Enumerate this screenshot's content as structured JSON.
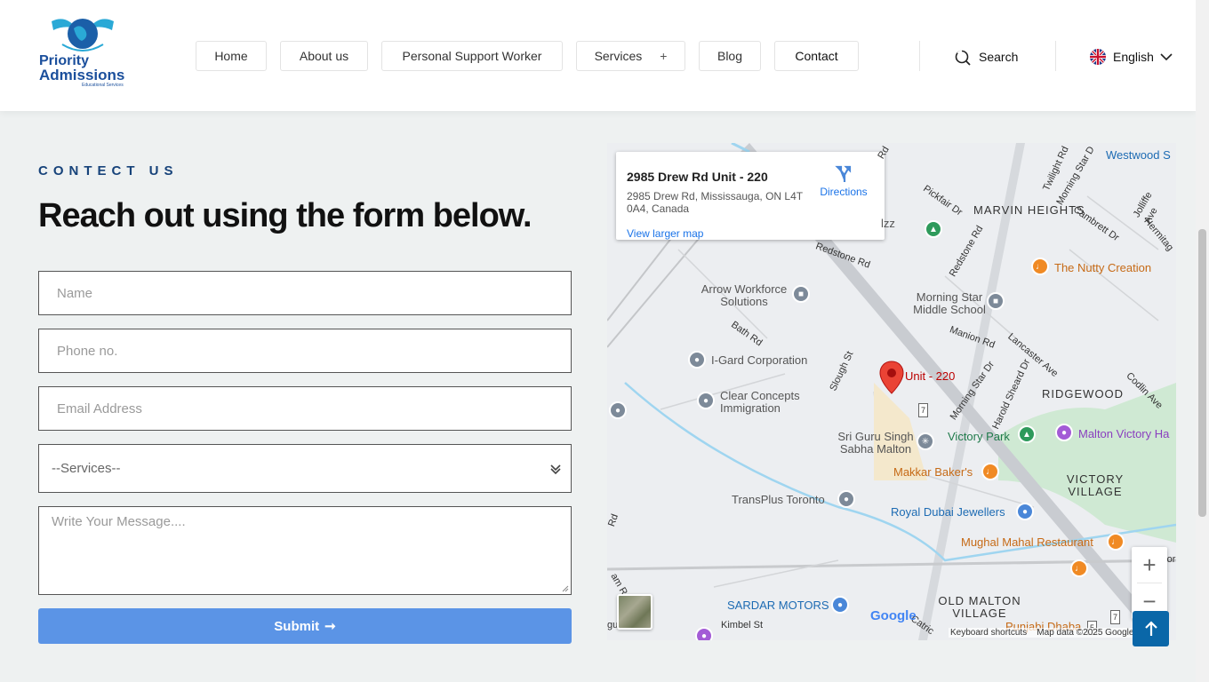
{
  "header": {
    "logo": {
      "line1": "Priority",
      "line2": "Admissions",
      "tagline": "Educational Services"
    },
    "nav": [
      {
        "label": "Home"
      },
      {
        "label": "About us"
      },
      {
        "label": "Personal Support Worker"
      },
      {
        "label": "Services",
        "expand": "+"
      },
      {
        "label": "Blog"
      },
      {
        "label": "Contact"
      }
    ],
    "search_label": "Search",
    "language": "English"
  },
  "contact": {
    "kicker": "CONTECT US",
    "heading": "Reach out using the form below.",
    "name_placeholder": "Name",
    "phone_placeholder": "Phone no.",
    "email_placeholder": "Email Address",
    "services_selected": "--Services--",
    "message_placeholder": "Write Your Message....",
    "submit_label": "Submit",
    "submit_arrow": "➞"
  },
  "map": {
    "card_title": "2985 Drew Rd Unit - 220",
    "card_address": "2985 Drew Rd, Mississauga, ON L4T 0A4, Canada",
    "view_larger": "View larger map",
    "directions": "Directions",
    "marker_label": "Unit - 220",
    "places": {
      "arrow": "Arrow Workforce Solutions",
      "igard": "I-Gard Corporation",
      "clear": "Clear Concepts Immigration",
      "gurdwara": "Sri Guru Singh Sabha Malton",
      "transplus": "TransPlus Toronto",
      "makkar": "Makkar Baker's",
      "dubai": "Royal Dubai Jewellers",
      "mughal": "Mughal Mahal Restaurant",
      "sardar": "SARDAR MOTORS",
      "punjabi": "Punjabi Dhaba",
      "victory_park": "Victory Park",
      "malton_victory": "Malton Victory Ha",
      "nutty": "The Nutty Creation",
      "morning_star_school": "Morning Star Middle School",
      "westwood": "Westwood S",
      "izz": "lzz"
    },
    "areas": {
      "marvin": "MARVIN HEIGHTS",
      "ridgewood": "RIDGEWOOD",
      "victory_village": "VICTORY VILLAGE",
      "old_malton": "OLD MALTON VILLAGE"
    },
    "streets": {
      "redstone1": "Redstone Rd",
      "redstone2": "Redstone Rd",
      "pickfair": "Pickfair Dr",
      "twilight": "Twilight Rd",
      "morning_star1": "Morning Star D",
      "cambrett": "Cambrett Dr",
      "jolliffe": "Jolliffe Ave",
      "hermitage": "Hermitag",
      "bath": "Bath Rd",
      "slough": "Slough St",
      "manion": "Manion Rd",
      "lancaster": "Lancaster Ave",
      "morning_star2": "Morning Star Dr",
      "harold": "Harold Sheard Dr",
      "codlin": "Codlin Ave",
      "kimbel": "Kimbel St",
      "rd": "Rd",
      "am_rd": "am R",
      "ctrl": "Catric",
      "route7a": "7",
      "route7b": "7",
      "route5": "5",
      "gu": "gu",
      "ror": "ror",
      "rd_left": "Rd"
    },
    "google": "Google",
    "shortcuts": "Keyboard shortcuts",
    "map_data": "Map data ©2025 Google",
    "terms": "Te",
    "zoom_in": "+",
    "zoom_out": "−"
  },
  "colors": {
    "primary_dark": "#17437a",
    "submit_bg": "#5b94e6",
    "to_top_bg": "#0a67a8",
    "page_bg": "#eef1f1"
  },
  "icons": {
    "search": "search-icon",
    "flag": "uk-flag-icon",
    "chevron": "chevron-down-icon",
    "directions": "directions-icon",
    "arrow_up": "arrow-up-icon",
    "marker": "map-marker-icon"
  }
}
